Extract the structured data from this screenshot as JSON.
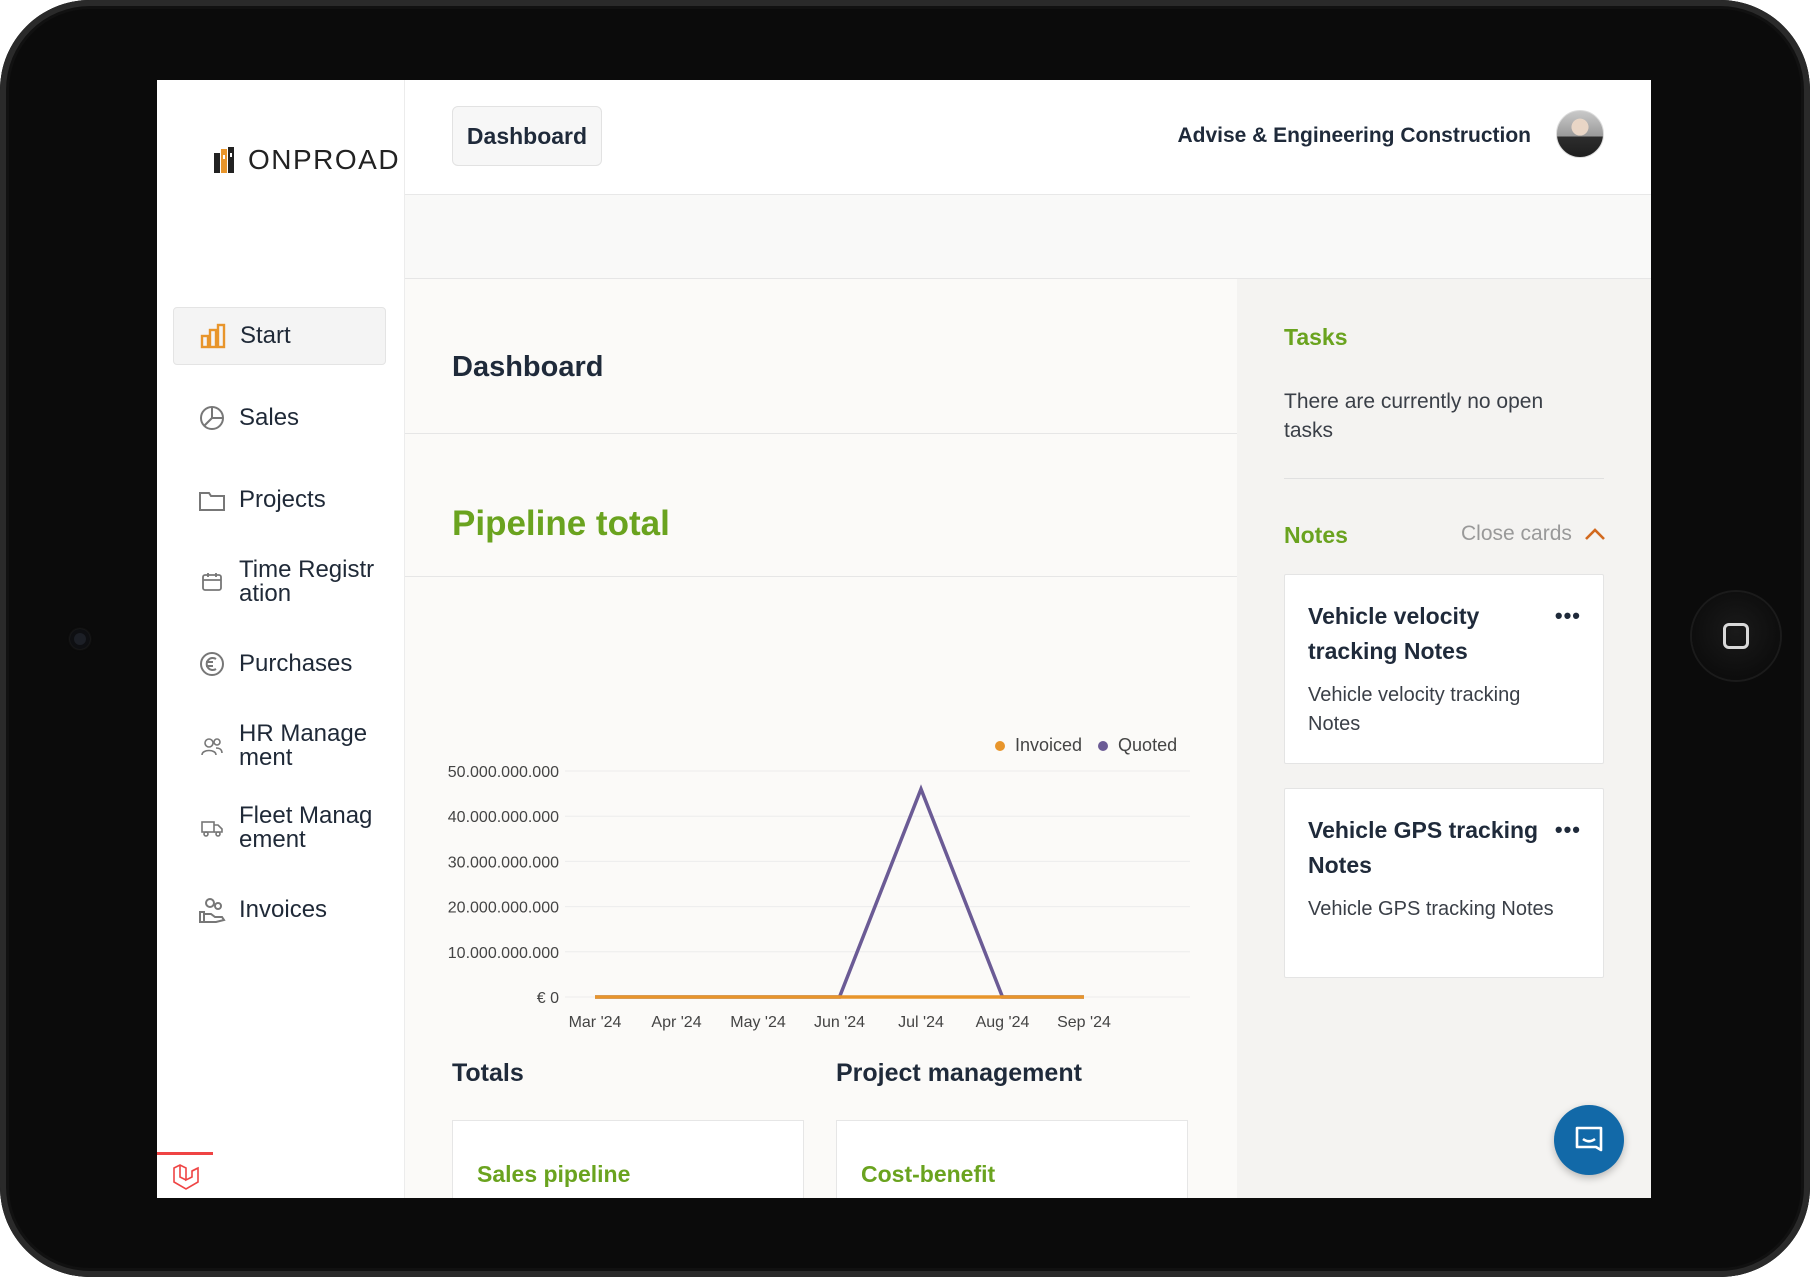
{
  "brand": {
    "logo_text": "ONPROAD"
  },
  "topbar": {
    "tab_label": "Dashboard",
    "company_name": "Advise & Engineering Construction"
  },
  "sidebar": {
    "items": [
      {
        "label": "Start",
        "icon": "bar-chart-icon",
        "active": true
      },
      {
        "label": "Sales",
        "icon": "pie-chart-icon"
      },
      {
        "label": "Projects",
        "icon": "folder-icon"
      },
      {
        "label": "Time Registr\nation",
        "line1": "Time Registr",
        "line2": "ation",
        "icon": "calendar-icon"
      },
      {
        "label": "Purchases",
        "icon": "euro-icon"
      },
      {
        "label": "HR Manage\nment",
        "line1": "HR Manage",
        "line2": "ment",
        "icon": "users-icon"
      },
      {
        "label": "Fleet Manag\nement",
        "line1": "Fleet Manag",
        "line2": "ement",
        "icon": "truck-icon"
      },
      {
        "label": "Invoices",
        "icon": "hand-coins-icon"
      }
    ]
  },
  "main": {
    "page_title": "Dashboard",
    "section_title": "Pipeline total",
    "totals_heading": "Totals",
    "project_heading": "Project management",
    "cards": [
      {
        "title": "Sales pipeline"
      },
      {
        "title": "Cost-benefit"
      }
    ]
  },
  "chart_data": {
    "type": "line",
    "x": [
      "Mar '24",
      "Apr '24",
      "May '24",
      "Jun '24",
      "Jul '24",
      "Aug '24",
      "Sep '24"
    ],
    "series": [
      {
        "name": "Invoiced",
        "color": "#e8952b",
        "values": [
          0,
          0,
          0,
          0,
          0,
          0,
          0
        ]
      },
      {
        "name": "Quoted",
        "color": "#6b5b95",
        "values": [
          0,
          0,
          0,
          0,
          46000000000,
          0,
          0
        ]
      }
    ],
    "y_ticks": [
      "€ 0",
      "€ 10.000.000.000",
      "€ 20.000.000.000",
      "€ 30.000.000.000",
      "€ 40.000.000.000",
      "€ 50.000.000.000"
    ],
    "ylim": [
      0,
      50000000000
    ],
    "legend_position": "top-right",
    "grid": true
  },
  "right_panel": {
    "tasks_heading": "Tasks",
    "tasks_empty": "There are currently no open tasks",
    "notes_heading": "Notes",
    "close_cards_label": "Close cards",
    "notes": [
      {
        "title": "Vehicle velocity tracking Notes",
        "body": "Vehicle velocity tracking Notes",
        "menu": "•••"
      },
      {
        "title": "Vehicle GPS tracking Notes",
        "body": "Vehicle GPS tracking Notes",
        "menu": "•••"
      }
    ]
  },
  "colors": {
    "accent_green": "#6aa31f",
    "invoiced": "#e8952b",
    "quoted": "#6b5b95",
    "chat_blue": "#1269a8"
  }
}
